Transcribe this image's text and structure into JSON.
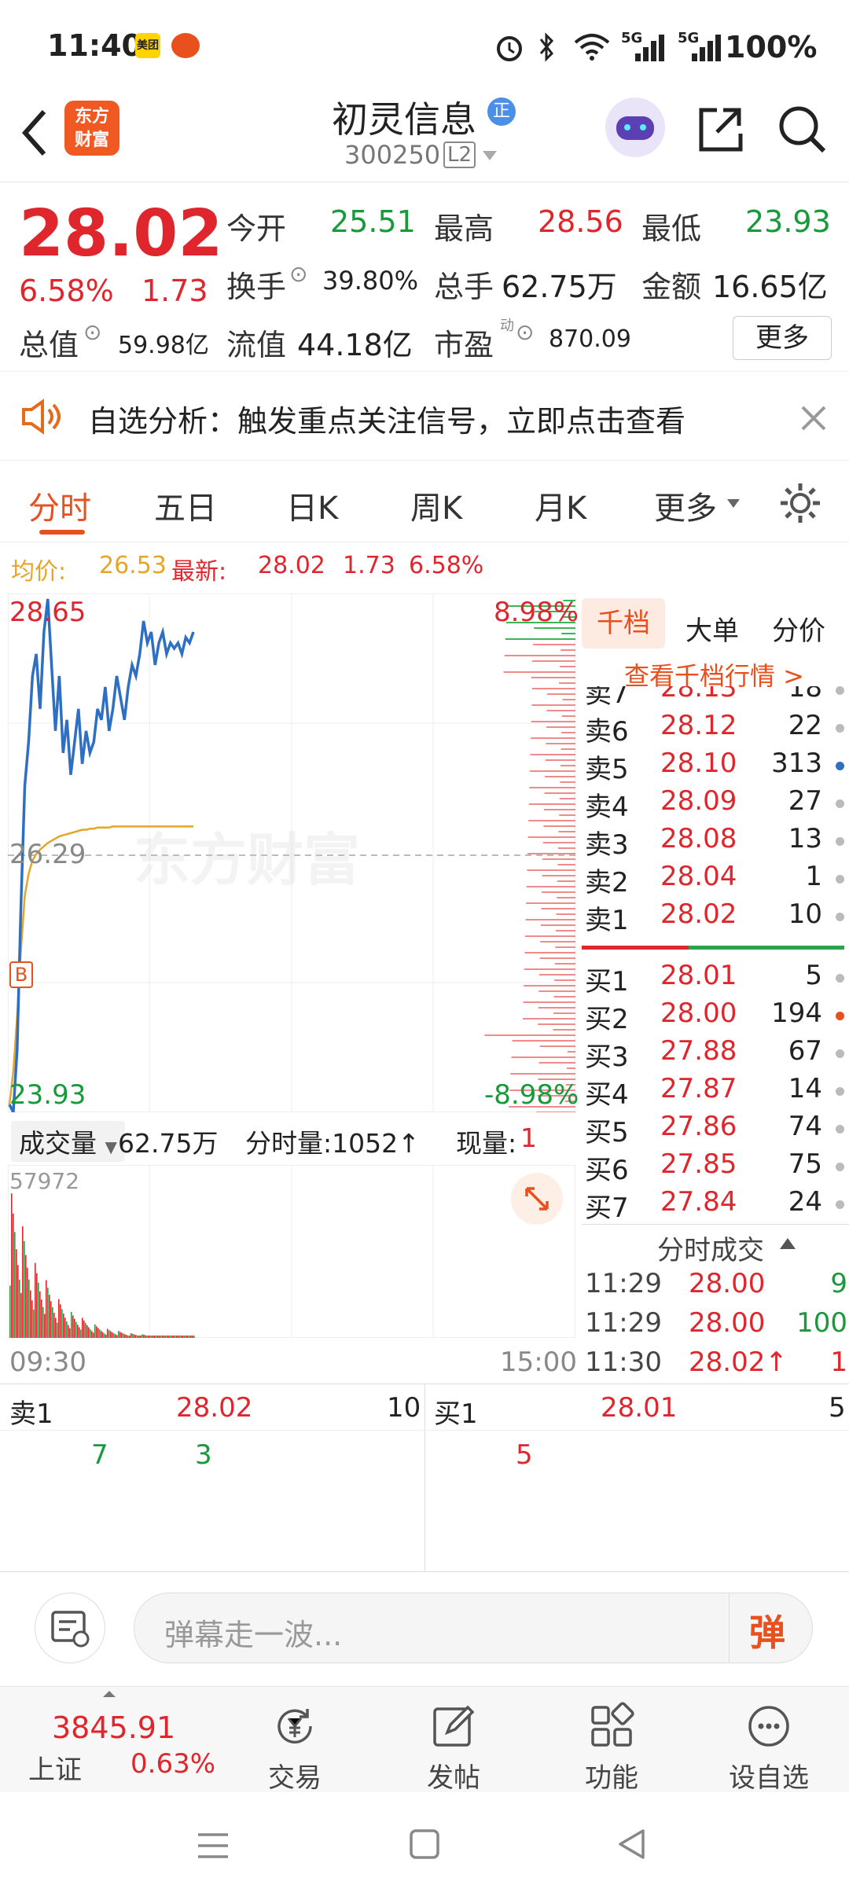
{
  "status": {
    "time": "11:40",
    "app1": "美团",
    "net1": "5G",
    "net2": "5G",
    "battery": "100%"
  },
  "header": {
    "logo_line1": "东方",
    "logo_line2": "财富",
    "stock_name": "初灵信息",
    "stock_badge": "正",
    "stock_code": "300250",
    "level": "L2"
  },
  "quote": {
    "price": "28.02",
    "change_pct": "6.58%",
    "change": "1.73",
    "open_label": "今开",
    "open": "25.51",
    "high_label": "最高",
    "high": "28.56",
    "low_label": "最低",
    "low": "23.93",
    "turnover_label": "换手",
    "turnover": "39.80%",
    "volume_label": "总手",
    "volume": "62.75万",
    "amount_label": "金额",
    "amount": "16.65亿",
    "mktcap_label": "总值",
    "mktcap": "59.98亿",
    "float_label": "流值",
    "float_cap": "44.18亿",
    "pe_label": "市盈",
    "pe_sup": "动",
    "pe": "870.09",
    "more": "更多"
  },
  "banner": {
    "text": "自选分析：触发重点关注信号，立即点击查看"
  },
  "tabs": [
    "分时",
    "五日",
    "日K",
    "周K",
    "月K",
    "更多"
  ],
  "avg": {
    "avg_label": "均价:",
    "avg": "26.53",
    "latest_label": "最新:",
    "latest": "28.02",
    "chg": "1.73",
    "pct": "6.58%"
  },
  "chart": {
    "top_price": "28.65",
    "mid_price": "26.29",
    "bottom_price": "23.93",
    "top_pct": "8.98%",
    "bottom_pct": "-8.98%",
    "watermark": "东方财富",
    "buy_marker": "B",
    "price_series": [
      24.0,
      23.93,
      24.5,
      25.8,
      26.9,
      27.3,
      27.9,
      28.1,
      27.6,
      28.3,
      28.6,
      28.0,
      27.4,
      27.9,
      27.2,
      27.5,
      27.0,
      27.3,
      27.6,
      27.1,
      27.4,
      27.2,
      27.3,
      27.6,
      27.5,
      27.8,
      27.4,
      27.6,
      27.9,
      27.7,
      27.5,
      27.8,
      28.0,
      27.9,
      28.1,
      28.4,
      28.2,
      28.3,
      28.0,
      28.2,
      28.3,
      28.1,
      28.2,
      28.15,
      28.2,
      28.1,
      28.25,
      28.2,
      28.3
    ],
    "avg_series": [
      24.0,
      24.3,
      24.8,
      25.4,
      25.9,
      26.1,
      26.22,
      26.28,
      26.32,
      26.35,
      26.38,
      26.4,
      26.42,
      26.44,
      26.45,
      26.46,
      26.47,
      26.48,
      26.49,
      26.5,
      26.5,
      26.51,
      26.51,
      26.52,
      26.52,
      26.52,
      26.52,
      26.53,
      26.53,
      26.53,
      26.53,
      26.53,
      26.53,
      26.53,
      26.53,
      26.53,
      26.53,
      26.53,
      26.53,
      26.53,
      26.53,
      26.53,
      26.53,
      26.53,
      26.53,
      26.53,
      26.53,
      26.53,
      26.53
    ]
  },
  "volume": {
    "label": "成交量",
    "total": "62.75万",
    "tick_label": "分时量:1052↑",
    "now_label": "现量:",
    "now": "1",
    "max": "57972"
  },
  "axis": {
    "start": "09:30",
    "end": "15:00"
  },
  "orderbook": {
    "tabs": [
      "千档",
      "大单",
      "分价"
    ],
    "view_all": "查看千档行情 >",
    "asks": [
      {
        "label": "卖7",
        "price": "28.13",
        "vol": "18"
      },
      {
        "label": "卖6",
        "price": "28.12",
        "vol": "22"
      },
      {
        "label": "卖5",
        "price": "28.10",
        "vol": "313"
      },
      {
        "label": "卖4",
        "price": "28.09",
        "vol": "27"
      },
      {
        "label": "卖3",
        "price": "28.08",
        "vol": "13"
      },
      {
        "label": "卖2",
        "price": "28.04",
        "vol": "1"
      },
      {
        "label": "卖1",
        "price": "28.02",
        "vol": "10"
      }
    ],
    "bids": [
      {
        "label": "买1",
        "price": "28.01",
        "vol": "5"
      },
      {
        "label": "买2",
        "price": "28.00",
        "vol": "194"
      },
      {
        "label": "买3",
        "price": "27.88",
        "vol": "67"
      },
      {
        "label": "买4",
        "price": "27.87",
        "vol": "14"
      },
      {
        "label": "买5",
        "price": "27.86",
        "vol": "74"
      },
      {
        "label": "买6",
        "price": "27.85",
        "vol": "75"
      },
      {
        "label": "买7",
        "price": "27.84",
        "vol": "24"
      }
    ],
    "trades_title": "分时成交",
    "trades": [
      {
        "time": "11:29",
        "price": "28.00",
        "vol": "9"
      },
      {
        "time": "11:29",
        "price": "28.00",
        "vol": "100"
      },
      {
        "time": "11:30",
        "price": "28.02↑",
        "vol": "1"
      }
    ]
  },
  "l2": {
    "sell_label": "卖1",
    "sell_price": "28.02",
    "sell_vol": "10",
    "sell_q1": "7",
    "sell_q2": "3",
    "buy_label": "买1",
    "buy_price": "28.01",
    "buy_vol": "5",
    "buy_q1": "5"
  },
  "danmu": {
    "placeholder": "弹幕走一波...",
    "btn": "弹"
  },
  "bottomnav": {
    "index_value": "3845.91",
    "index_name": "上证",
    "index_pct": "0.63%",
    "items": [
      "交易",
      "发帖",
      "功能",
      "设自选"
    ]
  }
}
